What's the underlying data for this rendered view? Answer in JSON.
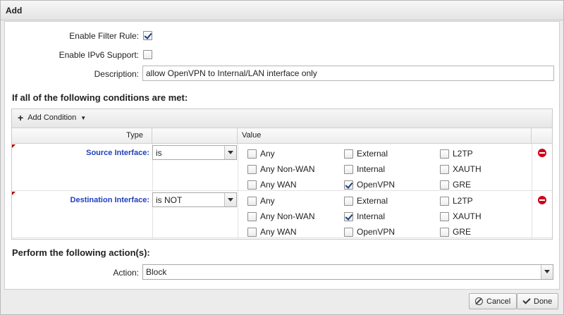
{
  "dialog": {
    "title": "Add"
  },
  "form": {
    "enable_filter_rule": {
      "label": "Enable Filter Rule:",
      "checked": true
    },
    "enable_ipv6": {
      "label": "Enable IPv6 Support:",
      "checked": false
    },
    "description": {
      "label": "Description:",
      "value": "allow OpenVPN to Internal/LAN interface only"
    }
  },
  "conditions": {
    "heading": "If all of the following conditions are met:",
    "add_condition_label": "Add Condition",
    "columns": {
      "type": "Type",
      "value": "Value"
    },
    "rows": [
      {
        "type_label": "Source Interface:",
        "operator": "is",
        "options": [
          {
            "label": "Any",
            "checked": false
          },
          {
            "label": "External",
            "checked": false
          },
          {
            "label": "L2TP",
            "checked": false
          },
          {
            "label": "Any Non-WAN",
            "checked": false
          },
          {
            "label": "Internal",
            "checked": false
          },
          {
            "label": "XAUTH",
            "checked": false
          },
          {
            "label": "Any WAN",
            "checked": false
          },
          {
            "label": "OpenVPN",
            "checked": true
          },
          {
            "label": "GRE",
            "checked": false
          }
        ]
      },
      {
        "type_label": "Destination Interface:",
        "operator": "is NOT",
        "options": [
          {
            "label": "Any",
            "checked": false
          },
          {
            "label": "External",
            "checked": false
          },
          {
            "label": "L2TP",
            "checked": false
          },
          {
            "label": "Any Non-WAN",
            "checked": false
          },
          {
            "label": "Internal",
            "checked": true
          },
          {
            "label": "XAUTH",
            "checked": false
          },
          {
            "label": "Any WAN",
            "checked": false
          },
          {
            "label": "OpenVPN",
            "checked": false
          },
          {
            "label": "GRE",
            "checked": false
          }
        ]
      }
    ]
  },
  "actions": {
    "heading": "Perform the following action(s):",
    "action_label": "Action:",
    "action_value": "Block"
  },
  "footer": {
    "cancel_label": "Cancel",
    "done_label": "Done"
  },
  "colors": {
    "type_label": "#1f3fbf",
    "remove_icon": "#d0021b",
    "required_marker": "#b30000"
  }
}
